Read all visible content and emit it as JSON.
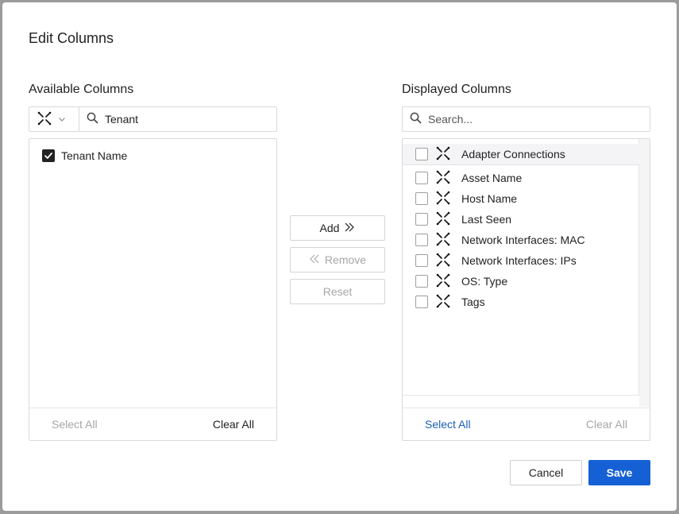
{
  "dialog": {
    "title": "Edit Columns"
  },
  "available": {
    "label": "Available Columns",
    "adapter_icon": "adapter-x-icon",
    "search_value": "Tenant",
    "items": [
      {
        "label": "Tenant Name",
        "checked": true
      }
    ],
    "select_all": "Select All",
    "clear_all": "Clear All"
  },
  "displayed": {
    "label": "Displayed Columns",
    "search_placeholder": "Search...",
    "items": [
      {
        "label": "Adapter Connections",
        "checked": false
      },
      {
        "label": "Asset Name",
        "checked": false
      },
      {
        "label": "Host Name",
        "checked": false
      },
      {
        "label": "Last Seen",
        "checked": false
      },
      {
        "label": "Network Interfaces: MAC",
        "checked": false
      },
      {
        "label": "Network Interfaces: IPs",
        "checked": false
      },
      {
        "label": "OS: Type",
        "checked": false
      },
      {
        "label": "Tags",
        "checked": false
      }
    ],
    "select_all": "Select All",
    "clear_all": "Clear All"
  },
  "actions": {
    "add": "Add",
    "remove": "Remove",
    "reset": "Reset"
  },
  "footer": {
    "cancel": "Cancel",
    "save": "Save"
  },
  "colors": {
    "primary": "#1560d4",
    "link": "#1a5fb4",
    "disabled": "#a6a6a6"
  }
}
